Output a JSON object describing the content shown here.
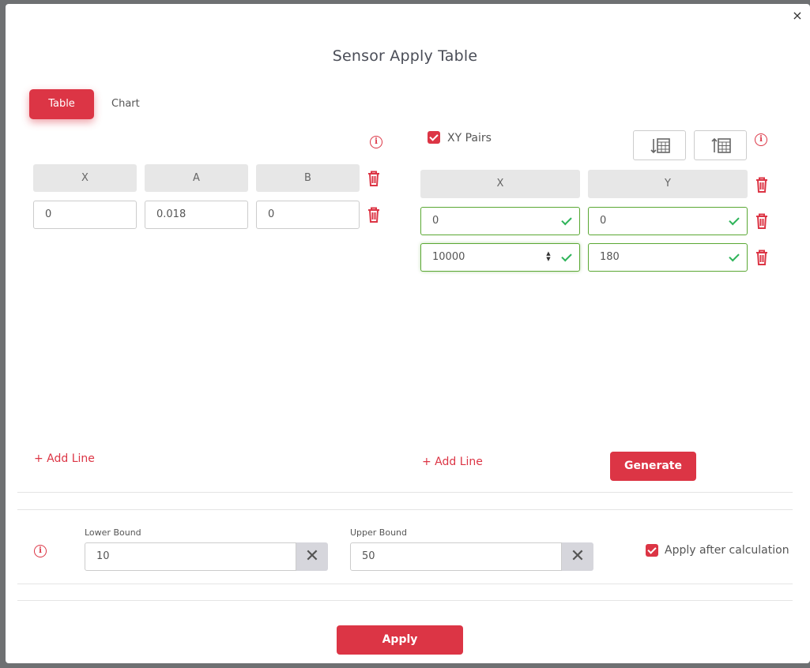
{
  "dialog": {
    "title": "Sensor Apply Table",
    "close_label": "×"
  },
  "tabs": [
    {
      "label": "Table",
      "active": true
    },
    {
      "label": "Chart",
      "active": false
    }
  ],
  "coefficients": {
    "columns": [
      "X",
      "A",
      "B"
    ],
    "rows": [
      [
        "0",
        "0.018",
        "0"
      ]
    ],
    "add_line": "+ Add Line"
  },
  "xy_pairs": {
    "checkbox_label": "XY Pairs",
    "checked": true,
    "columns": [
      "X",
      "Y"
    ],
    "rows": [
      [
        "0",
        "0"
      ],
      [
        "10000",
        "180"
      ]
    ],
    "add_line": "+ Add Line",
    "generate_label": "Generate"
  },
  "bounds": {
    "lower_label": "Lower Bound",
    "lower_value": "10",
    "upper_label": "Upper Bound",
    "upper_value": "50",
    "apply_after_label": "Apply after calculation",
    "apply_after_checked": true
  },
  "footer": {
    "apply_label": "Apply"
  },
  "colors": {
    "accent": "#dc3545",
    "valid": "#5aa833",
    "check": "#2fb45a"
  }
}
